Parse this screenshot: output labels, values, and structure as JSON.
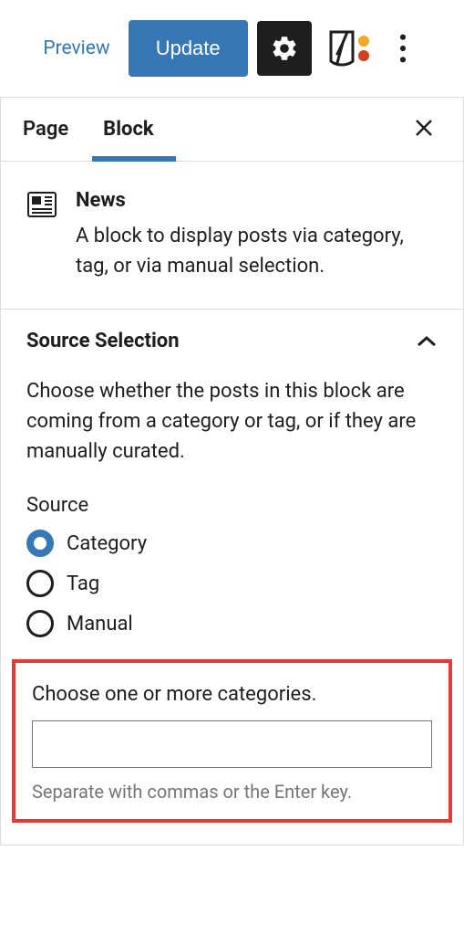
{
  "toolbar": {
    "preview": "Preview",
    "update": "Update"
  },
  "tabs": {
    "page": "Page",
    "block": "Block"
  },
  "block": {
    "title": "News",
    "description": "A block to display posts via category, tag, or via manual selection."
  },
  "source_section": {
    "title": "Source Selection",
    "description": "Choose whether the posts in this block are coming from a category or tag, or if they are manually curated.",
    "source_label": "Source",
    "options": {
      "category": "Category",
      "tag": "Tag",
      "manual": "Manual"
    },
    "categories_label": "Choose one or more categories.",
    "categories_help": "Separate with commas or the Enter key."
  }
}
